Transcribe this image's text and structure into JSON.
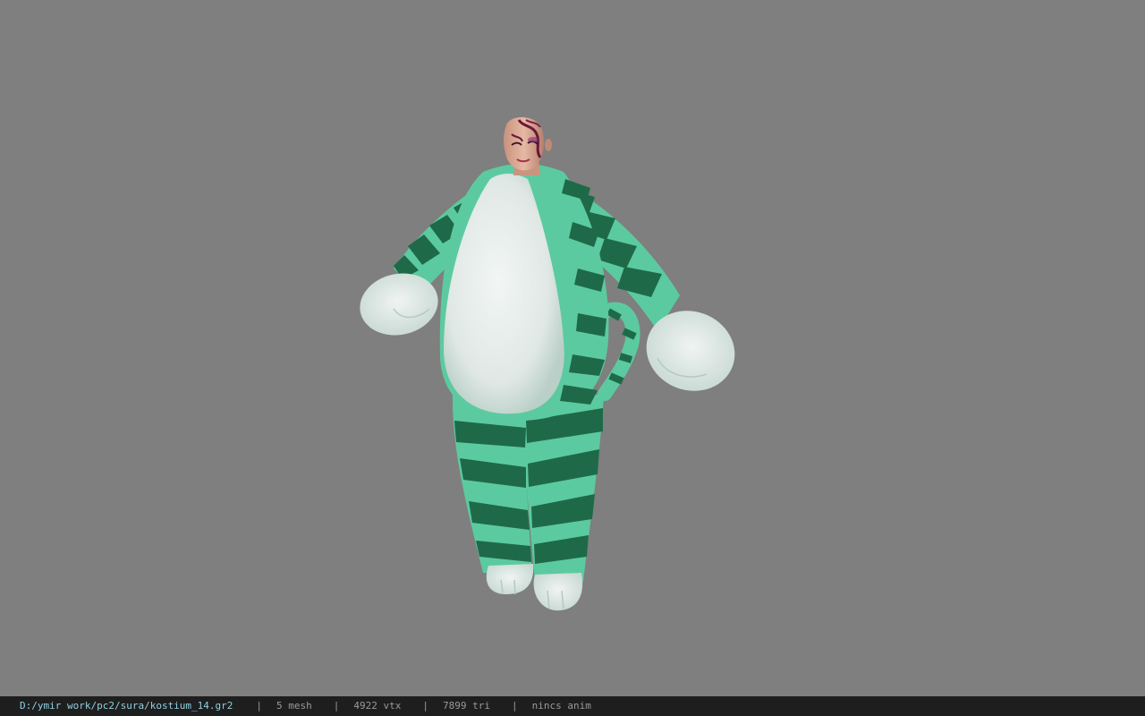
{
  "viewer": {
    "background_color": "#7f7f7f",
    "model": {
      "name": "green-striped-cat-costume-character",
      "colors": {
        "fur_light": "#5ccaa0",
        "fur_dark": "#1e6a48",
        "belly": "#e8eeec",
        "skin": "#d8a890",
        "hair_mark": "#6a1838"
      }
    }
  },
  "statusbar": {
    "path": "D:/ymir work/pc2/sura/kostium_14.gr2",
    "separator": "|",
    "mesh": "5 mesh",
    "vtx": "4922 vtx",
    "tri": "7899 tri",
    "anim": "nincs anim"
  }
}
